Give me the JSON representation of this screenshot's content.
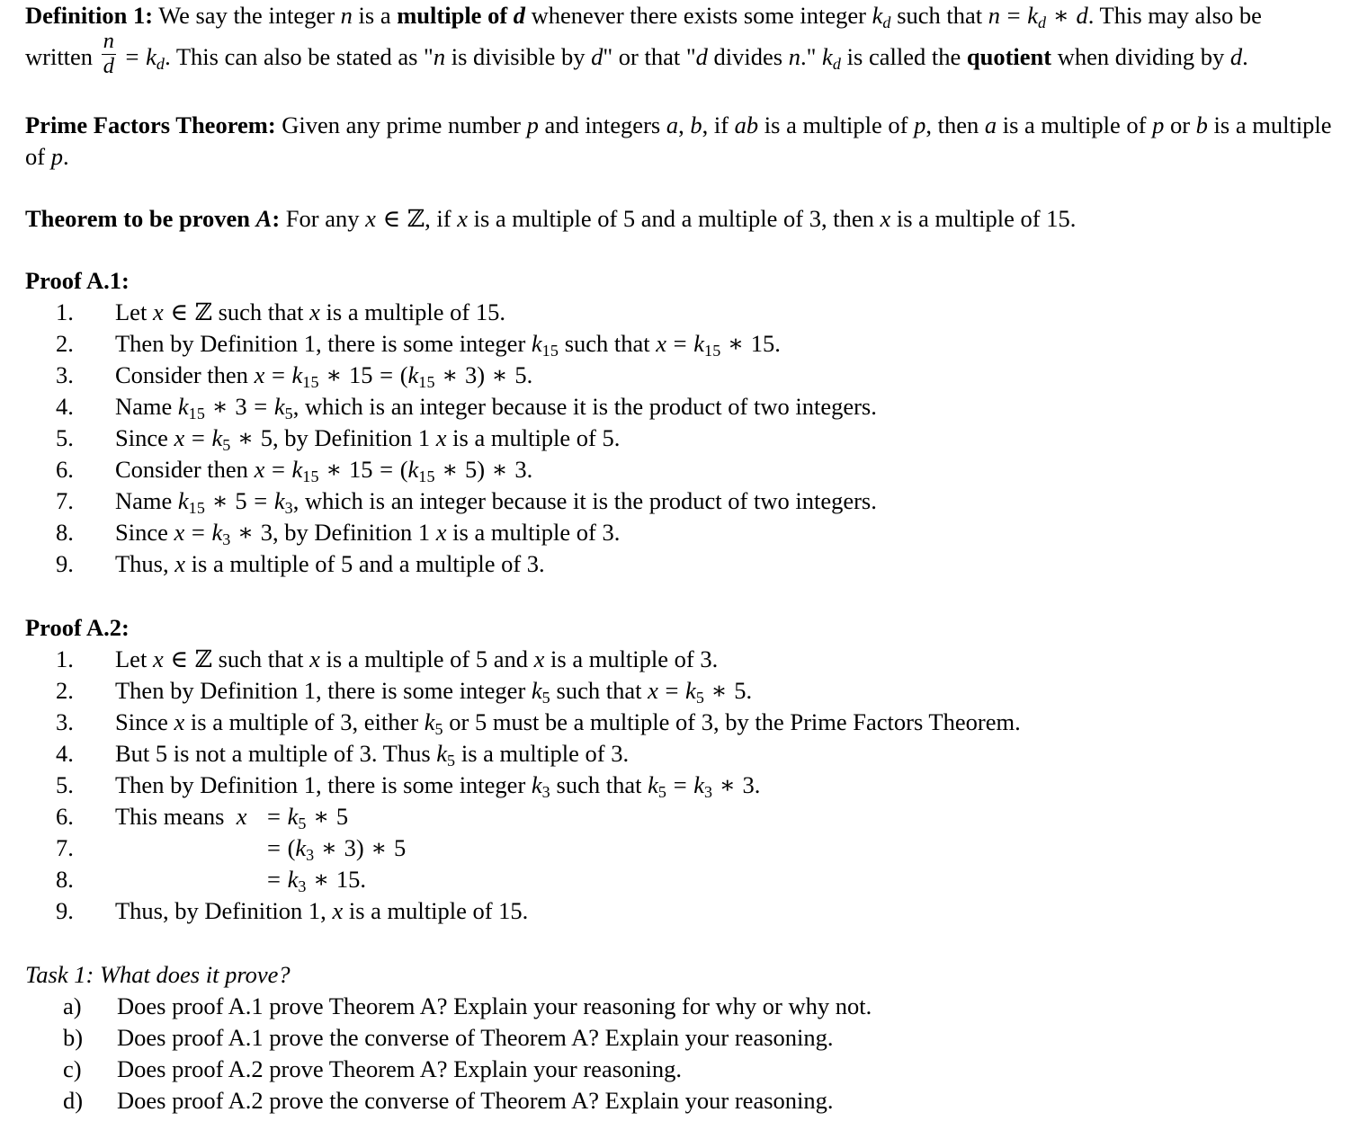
{
  "document": {
    "definition": {
      "label": "Definition 1:",
      "text_1": "We say the integer ",
      "var_n": "n",
      "text_2": " is a ",
      "bold_phrase": "multiple of ",
      "bold_var_d": "d",
      "text_3": " whenever there exists some integer ",
      "var_k": "k",
      "sub_d": "d",
      "text_4": " such that ",
      "eq_n": "n",
      "eq_sign": " = ",
      "eq_k": "k",
      "eq_sub_d": "d",
      "eq_star": " ∗ ",
      "eq_d": "d",
      "text_5": ". This may also be written ",
      "frac_num": "n",
      "frac_den": "d",
      "text_6": " = ",
      "text_7": ". This can also be stated as \"",
      "quote_n": "n",
      "text_8": " is divisible by ",
      "quote_d": "d",
      "text_9": "\" or that \"",
      "quote_d2": "d",
      "text_10": " divides ",
      "quote_n2": "n",
      "text_11": ".\" ",
      "text_12": " is called the ",
      "bold_quotient": "quotient",
      "text_13": " when dividing by ",
      "final_d": "d",
      "text_14": "."
    },
    "prime_factors_theorem": {
      "label": "Prime Factors Theorem:",
      "text_1": "Given any prime number ",
      "var_p": "p",
      "text_2": " and integers ",
      "var_a": "a",
      "comma": ", ",
      "var_b": "b",
      "text_3": ", if ",
      "var_ab_a": "a",
      "var_ab_b": "b",
      "text_4": " is a multiple of ",
      "var_p2": "p",
      "text_5": ", then ",
      "var_a2": "a",
      "text_6": " is a multiple of ",
      "var_p3": "p",
      "text_7": " or ",
      "var_b2": "b",
      "text_8": " is a multiple of ",
      "var_p4": "p",
      "text_9": "."
    },
    "theorem_a": {
      "label_text": "Theorem to be proven ",
      "label_var": "A",
      "label_colon": ":",
      "text_1": "For any ",
      "var_x": "x",
      "elem": " ∈ ",
      "set_z": "ℤ",
      "text_2": ", if ",
      "var_x2": "x",
      "text_3": " is a multiple of 5 and a multiple of 3, then ",
      "var_x3": "x",
      "text_4": " is a multiple of 15."
    },
    "proof_a1": {
      "heading": "Proof A.1:",
      "items": [
        {
          "marker": "1.",
          "html_id": "a1-1"
        },
        {
          "marker": "2.",
          "html_id": "a1-2"
        },
        {
          "marker": "3.",
          "html_id": "a1-3"
        },
        {
          "marker": "4.",
          "html_id": "a1-4"
        },
        {
          "marker": "5.",
          "html_id": "a1-5"
        },
        {
          "marker": "6.",
          "html_id": "a1-6"
        },
        {
          "marker": "7.",
          "html_id": "a1-7"
        },
        {
          "marker": "8.",
          "html_id": "a1-8"
        },
        {
          "marker": "9.",
          "html_id": "a1-9"
        }
      ],
      "plain_text": [
        "Let x ∈ ℤ such that x is a multiple of 15.",
        "Then by Definition 1, there is some integer k15 such that x = k15 ∗ 15.",
        "Consider then x = k15 ∗ 15 = (k15 ∗ 3) ∗ 5.",
        "Name k15 ∗ 3 = k5, which is an integer because it is the product of two integers.",
        "Since x = k5 ∗ 5, by Definition 1 x is a multiple of 5.",
        "Consider then x = k15 ∗ 15 = (k15 ∗ 5) ∗ 3.",
        "Name k15 ∗ 5 = k3, which is an integer because it is the product of two integers.",
        "Since x = k3 ∗ 3, by Definition 1 x is a multiple of 3.",
        "Thus, x is a multiple of 5 and a multiple of 3."
      ]
    },
    "proof_a2": {
      "heading": "Proof A.2:",
      "items": [
        {
          "marker": "1."
        },
        {
          "marker": "2."
        },
        {
          "marker": "3."
        },
        {
          "marker": "4."
        },
        {
          "marker": "5."
        },
        {
          "marker": "6."
        },
        {
          "marker": "7."
        },
        {
          "marker": "8."
        },
        {
          "marker": "9."
        }
      ],
      "plain_text": [
        "Let x ∈ ℤ such that x is a multiple of 5 and x is a multiple of 3.",
        "Then by Definition 1, there is some integer k5 such that x = k5 ∗ 5.",
        "Since x is a multiple of 3, either k5 or 5 must be a multiple of 3, by the Prime Factors Theorem.",
        "But 5 is not a multiple of 3. Thus k5 is a multiple of 3.",
        "Then by Definition 1, there is some integer k3 such that k5 = k3 ∗ 3.",
        "This means  x = k5 ∗ 5",
        "= (k3 ∗ 3) ∗ 5",
        "= k3 ∗ 15.",
        "Thus, by Definition 1, x is a multiple of 15."
      ]
    },
    "task": {
      "heading_label": "Task 1:",
      "heading_text": " What does it prove?",
      "items": [
        {
          "marker": "a)",
          "text": "Does proof A.1 prove Theorem A? Explain your reasoning for why or why not."
        },
        {
          "marker": "b)",
          "text": "Does proof A.1 prove the converse of Theorem A? Explain your reasoning."
        },
        {
          "marker": "c)",
          "text": "Does proof A.2 prove Theorem A? Explain your reasoning."
        },
        {
          "marker": "d)",
          "text": "Does proof A.2 prove the converse of Theorem A? Explain your reasoning."
        }
      ]
    },
    "symbols": {
      "star": "∗",
      "equals": "=",
      "element_of": "∈",
      "integers_set": "ℤ"
    },
    "colors": {
      "text": "#000000",
      "background": "#ffffff"
    }
  }
}
